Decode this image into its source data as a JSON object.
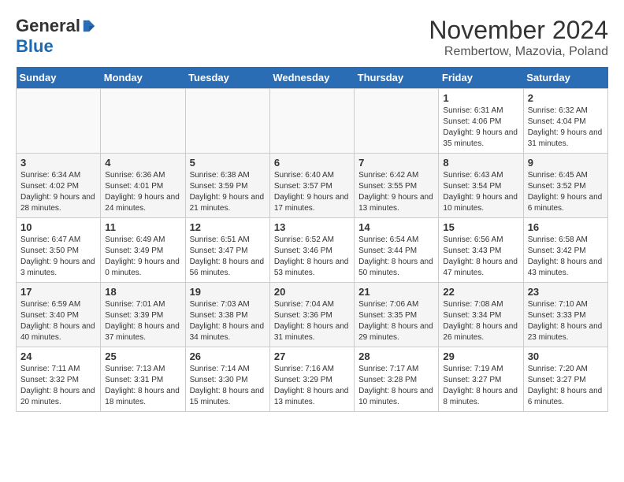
{
  "logo": {
    "general": "General",
    "blue": "Blue"
  },
  "title": "November 2024",
  "location": "Rembertow, Mazovia, Poland",
  "headers": [
    "Sunday",
    "Monday",
    "Tuesday",
    "Wednesday",
    "Thursday",
    "Friday",
    "Saturday"
  ],
  "rows": [
    [
      {
        "day": "",
        "info": ""
      },
      {
        "day": "",
        "info": ""
      },
      {
        "day": "",
        "info": ""
      },
      {
        "day": "",
        "info": ""
      },
      {
        "day": "",
        "info": ""
      },
      {
        "day": "1",
        "info": "Sunrise: 6:31 AM\nSunset: 4:06 PM\nDaylight: 9 hours and 35 minutes."
      },
      {
        "day": "2",
        "info": "Sunrise: 6:32 AM\nSunset: 4:04 PM\nDaylight: 9 hours and 31 minutes."
      }
    ],
    [
      {
        "day": "3",
        "info": "Sunrise: 6:34 AM\nSunset: 4:02 PM\nDaylight: 9 hours and 28 minutes."
      },
      {
        "day": "4",
        "info": "Sunrise: 6:36 AM\nSunset: 4:01 PM\nDaylight: 9 hours and 24 minutes."
      },
      {
        "day": "5",
        "info": "Sunrise: 6:38 AM\nSunset: 3:59 PM\nDaylight: 9 hours and 21 minutes."
      },
      {
        "day": "6",
        "info": "Sunrise: 6:40 AM\nSunset: 3:57 PM\nDaylight: 9 hours and 17 minutes."
      },
      {
        "day": "7",
        "info": "Sunrise: 6:42 AM\nSunset: 3:55 PM\nDaylight: 9 hours and 13 minutes."
      },
      {
        "day": "8",
        "info": "Sunrise: 6:43 AM\nSunset: 3:54 PM\nDaylight: 9 hours and 10 minutes."
      },
      {
        "day": "9",
        "info": "Sunrise: 6:45 AM\nSunset: 3:52 PM\nDaylight: 9 hours and 6 minutes."
      }
    ],
    [
      {
        "day": "10",
        "info": "Sunrise: 6:47 AM\nSunset: 3:50 PM\nDaylight: 9 hours and 3 minutes."
      },
      {
        "day": "11",
        "info": "Sunrise: 6:49 AM\nSunset: 3:49 PM\nDaylight: 9 hours and 0 minutes."
      },
      {
        "day": "12",
        "info": "Sunrise: 6:51 AM\nSunset: 3:47 PM\nDaylight: 8 hours and 56 minutes."
      },
      {
        "day": "13",
        "info": "Sunrise: 6:52 AM\nSunset: 3:46 PM\nDaylight: 8 hours and 53 minutes."
      },
      {
        "day": "14",
        "info": "Sunrise: 6:54 AM\nSunset: 3:44 PM\nDaylight: 8 hours and 50 minutes."
      },
      {
        "day": "15",
        "info": "Sunrise: 6:56 AM\nSunset: 3:43 PM\nDaylight: 8 hours and 47 minutes."
      },
      {
        "day": "16",
        "info": "Sunrise: 6:58 AM\nSunset: 3:42 PM\nDaylight: 8 hours and 43 minutes."
      }
    ],
    [
      {
        "day": "17",
        "info": "Sunrise: 6:59 AM\nSunset: 3:40 PM\nDaylight: 8 hours and 40 minutes."
      },
      {
        "day": "18",
        "info": "Sunrise: 7:01 AM\nSunset: 3:39 PM\nDaylight: 8 hours and 37 minutes."
      },
      {
        "day": "19",
        "info": "Sunrise: 7:03 AM\nSunset: 3:38 PM\nDaylight: 8 hours and 34 minutes."
      },
      {
        "day": "20",
        "info": "Sunrise: 7:04 AM\nSunset: 3:36 PM\nDaylight: 8 hours and 31 minutes."
      },
      {
        "day": "21",
        "info": "Sunrise: 7:06 AM\nSunset: 3:35 PM\nDaylight: 8 hours and 29 minutes."
      },
      {
        "day": "22",
        "info": "Sunrise: 7:08 AM\nSunset: 3:34 PM\nDaylight: 8 hours and 26 minutes."
      },
      {
        "day": "23",
        "info": "Sunrise: 7:10 AM\nSunset: 3:33 PM\nDaylight: 8 hours and 23 minutes."
      }
    ],
    [
      {
        "day": "24",
        "info": "Sunrise: 7:11 AM\nSunset: 3:32 PM\nDaylight: 8 hours and 20 minutes."
      },
      {
        "day": "25",
        "info": "Sunrise: 7:13 AM\nSunset: 3:31 PM\nDaylight: 8 hours and 18 minutes."
      },
      {
        "day": "26",
        "info": "Sunrise: 7:14 AM\nSunset: 3:30 PM\nDaylight: 8 hours and 15 minutes."
      },
      {
        "day": "27",
        "info": "Sunrise: 7:16 AM\nSunset: 3:29 PM\nDaylight: 8 hours and 13 minutes."
      },
      {
        "day": "28",
        "info": "Sunrise: 7:17 AM\nSunset: 3:28 PM\nDaylight: 8 hours and 10 minutes."
      },
      {
        "day": "29",
        "info": "Sunrise: 7:19 AM\nSunset: 3:27 PM\nDaylight: 8 hours and 8 minutes."
      },
      {
        "day": "30",
        "info": "Sunrise: 7:20 AM\nSunset: 3:27 PM\nDaylight: 8 hours and 6 minutes."
      }
    ]
  ]
}
